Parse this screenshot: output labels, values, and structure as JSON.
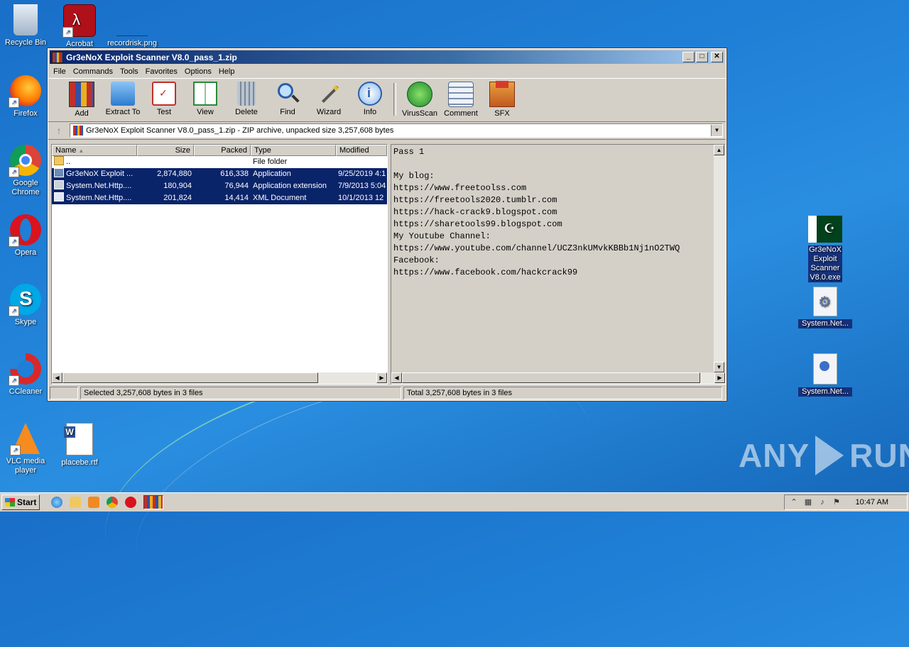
{
  "desktop": {
    "left_icons": [
      {
        "label": "Recycle Bin"
      },
      {
        "label": "Acrobat"
      },
      {
        "label": "recordrisk.png"
      },
      {
        "label": "Firefox"
      },
      {
        "label": "Google Chrome"
      },
      {
        "label": "Opera"
      },
      {
        "label": "Skype"
      },
      {
        "label": "CCleaner"
      },
      {
        "label": "VLC media player"
      },
      {
        "label": "placebe.rtf"
      }
    ],
    "right_icons": [
      {
        "label": "Gr3eNoX Exploit Scanner V8.0.exe"
      },
      {
        "label": "System.Net..."
      },
      {
        "label": "System.Net..."
      }
    ],
    "watermark_left": "ANY",
    "watermark_right": "RUN"
  },
  "window": {
    "title": "Gr3eNoX Exploit Scanner V8.0_pass_1.zip",
    "menu": [
      "File",
      "Commands",
      "Tools",
      "Favorites",
      "Options",
      "Help"
    ],
    "toolbar": [
      {
        "label": "Add",
        "icon": "add-icon"
      },
      {
        "label": "Extract To",
        "icon": "extract-folder-icon"
      },
      {
        "label": "Test",
        "icon": "test-clipboard-icon"
      },
      {
        "label": "View",
        "icon": "view-book-icon"
      },
      {
        "label": "Delete",
        "icon": "trash-icon"
      },
      {
        "label": "Find",
        "icon": "magnifier-icon"
      },
      {
        "label": "Wizard",
        "icon": "wand-icon"
      },
      {
        "label": "Info",
        "icon": "info-icon"
      },
      {
        "label": "VirusScan",
        "icon": "bug-icon"
      },
      {
        "label": "Comment",
        "icon": "comment-icon"
      },
      {
        "label": "SFX",
        "icon": "sfx-box-icon"
      }
    ],
    "address": "Gr3eNoX Exploit Scanner V8.0_pass_1.zip - ZIP archive, unpacked size 3,257,608 bytes",
    "columns": [
      "Name",
      "Size",
      "Packed",
      "Type",
      "Modified"
    ],
    "files": [
      {
        "name": "..",
        "size": "",
        "packed": "",
        "type": "File folder",
        "modified": ""
      },
      {
        "name": "Gr3eNoX Exploit ...",
        "size": "2,874,880",
        "packed": "616,338",
        "type": "Application",
        "modified": "9/25/2019 4:1"
      },
      {
        "name": "System.Net.Http....",
        "size": "180,904",
        "packed": "76,944",
        "type": "Application extension",
        "modified": "7/9/2013 5:04"
      },
      {
        "name": "System.Net.Http....",
        "size": "201,824",
        "packed": "14,414",
        "type": "XML Document",
        "modified": "10/1/2013 12"
      }
    ],
    "comment": "Pass 1\n\nMy blog:\nhttps://www.freetoolss.com\nhttps://freetools2020.tumblr.com\nhttps://hack-crack9.blogspot.com\nhttps://sharetools99.blogspot.com\nMy Youtube Channel:\nhttps://www.youtube.com/channel/UCZ3nkUMvkKBBb1Nj1nO2TWQ\nFacebook:\nhttps://www.facebook.com/hackcrack99",
    "status_left": "Selected 3,257,608 bytes in 3 files",
    "status_right": "Total 3,257,608 bytes in 3 files"
  },
  "taskbar": {
    "start": "Start",
    "clock": "10:47 AM"
  }
}
